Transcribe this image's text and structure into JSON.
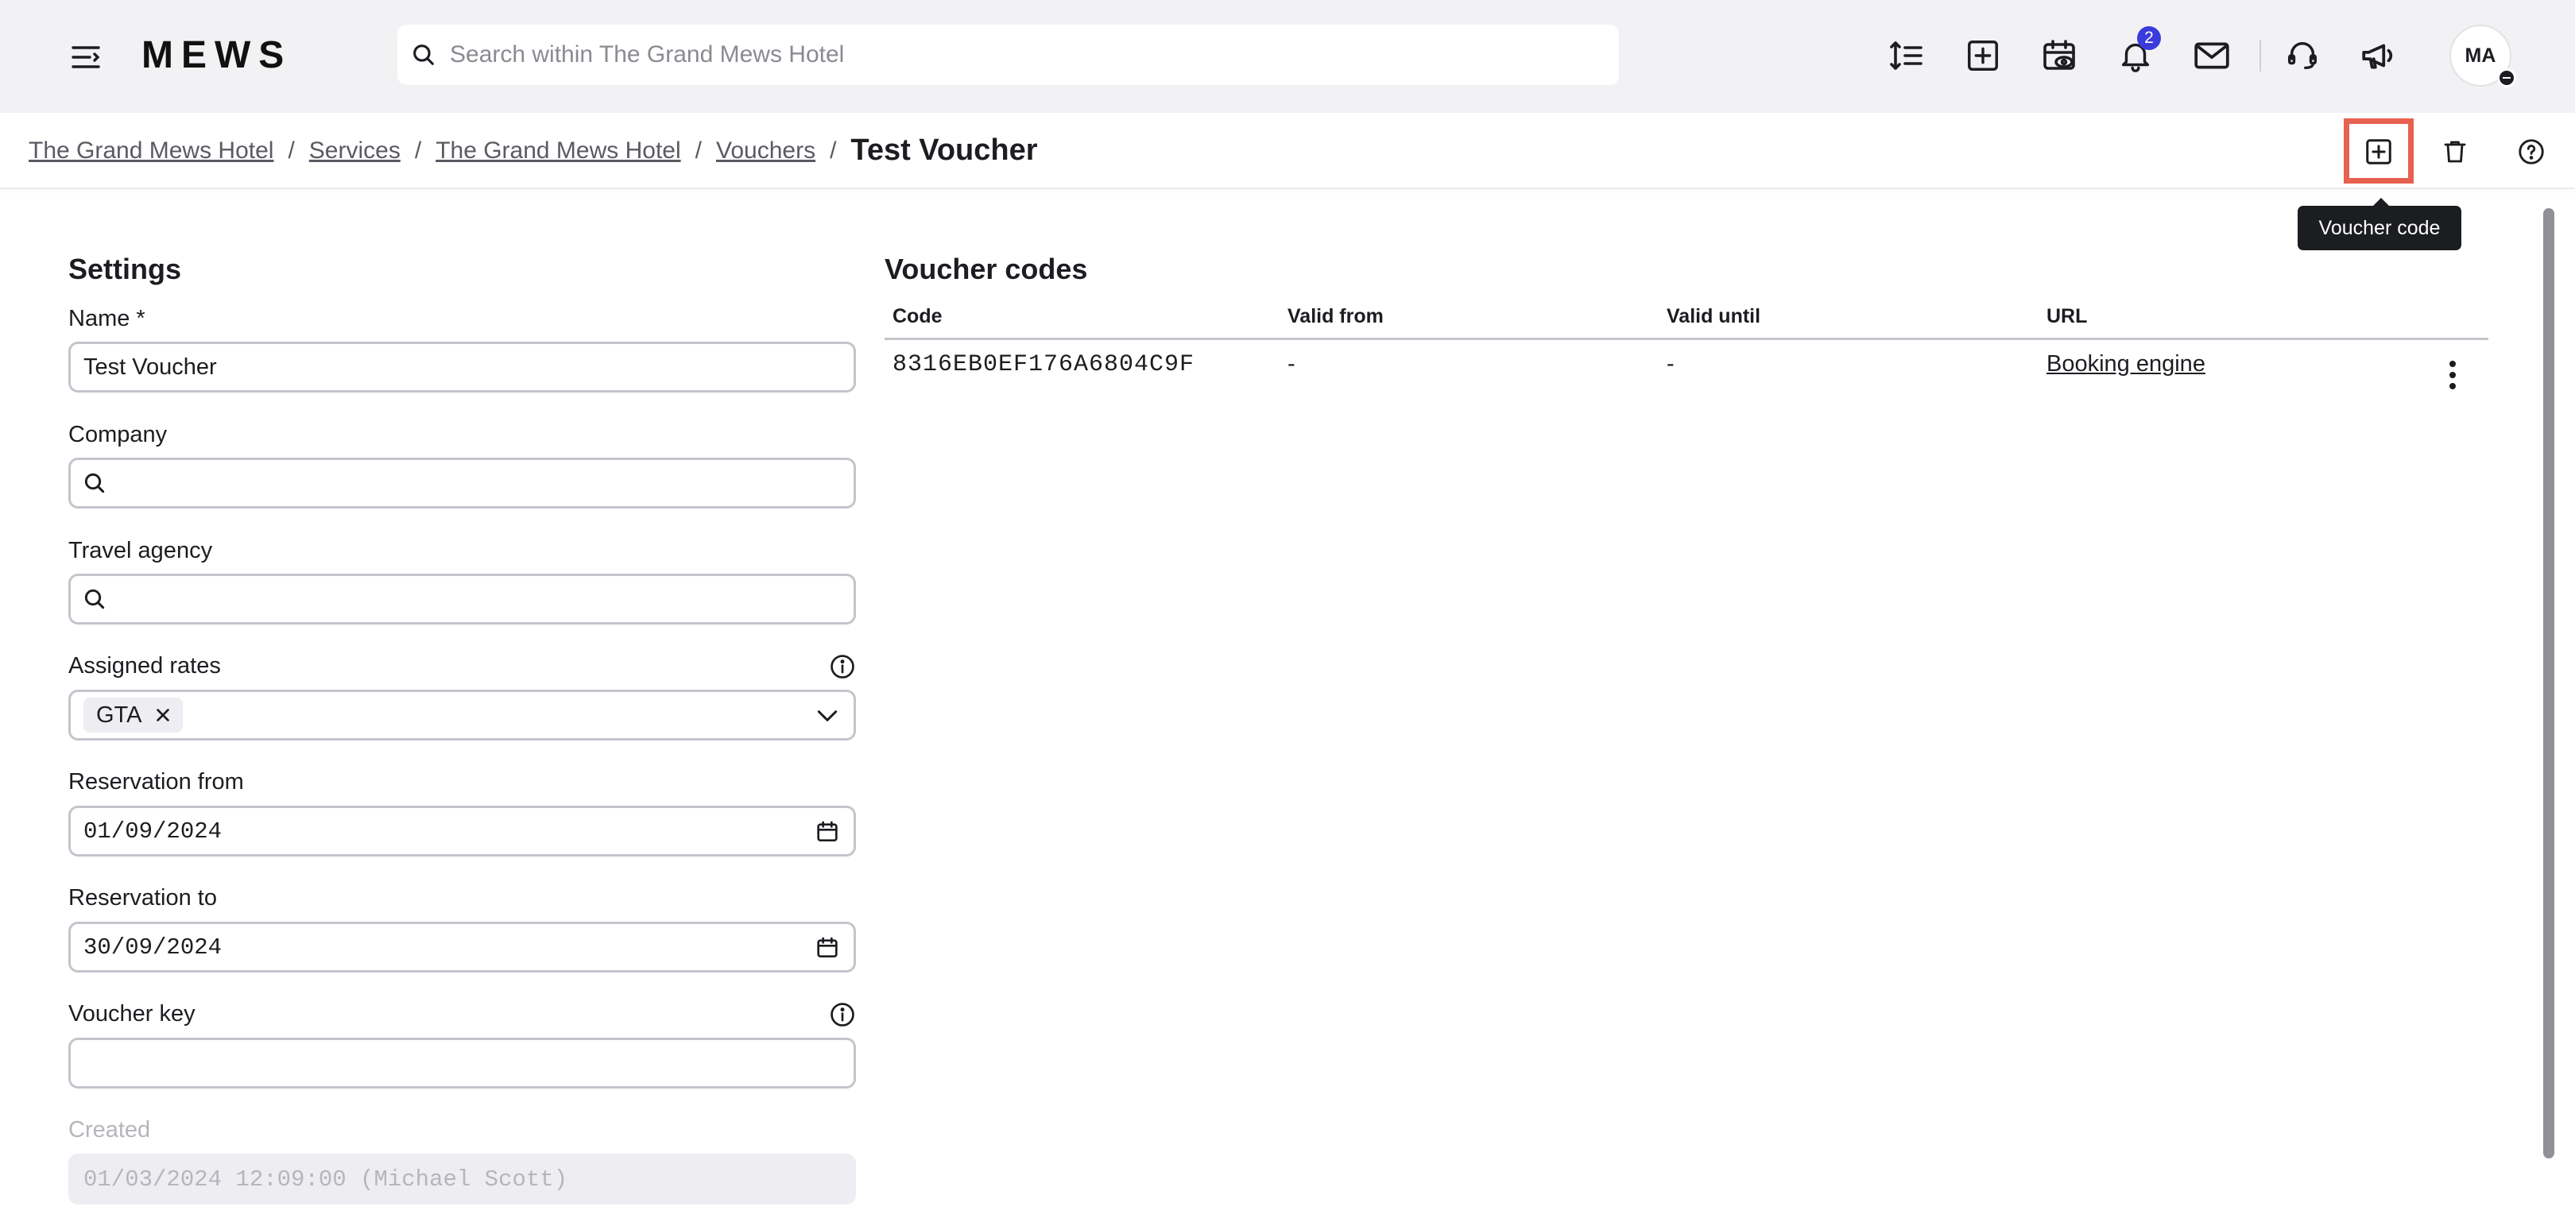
{
  "app": {
    "logo": "MEWS"
  },
  "search": {
    "placeholder": "Search within The Grand Mews Hotel",
    "value": ""
  },
  "topbar": {
    "icons": [
      "line-spacing-icon",
      "add-square-icon",
      "calendar-view-icon",
      "bell-icon",
      "mail-icon",
      "headset-icon",
      "megaphone-icon"
    ],
    "notification_count": "2",
    "user_initials": "MA"
  },
  "breadcrumb": {
    "items": [
      "The Grand Mews Hotel",
      "Services",
      "The Grand Mews Hotel",
      "Vouchers"
    ],
    "separator": "/",
    "current": "Test Voucher"
  },
  "actions": {
    "add_code_icon": "add-square-icon",
    "delete_icon": "trash-icon",
    "help_icon": "help-circle-icon",
    "tooltip": "Voucher code"
  },
  "settings": {
    "title": "Settings",
    "name": {
      "label": "Name *",
      "value": "Test Voucher"
    },
    "company": {
      "label": "Company",
      "value": ""
    },
    "travel_agency": {
      "label": "Travel agency",
      "value": ""
    },
    "assigned_rates": {
      "label": "Assigned rates",
      "chips": [
        "GTA"
      ]
    },
    "reservation_from": {
      "label": "Reservation from",
      "value": "01/09/2024"
    },
    "reservation_to": {
      "label": "Reservation to",
      "value": "30/09/2024"
    },
    "voucher_key": {
      "label": "Voucher key",
      "value": ""
    },
    "created": {
      "label": "Created",
      "value": "01/03/2024 12:09:00 (Michael Scott)"
    }
  },
  "voucher_codes": {
    "title": "Voucher codes",
    "columns": [
      "Code",
      "Valid from",
      "Valid until",
      "URL"
    ],
    "rows": [
      {
        "code": "8316EB0EF176A6804C9F",
        "valid_from": "-",
        "valid_until": "-",
        "url": "Booking engine"
      }
    ]
  }
}
